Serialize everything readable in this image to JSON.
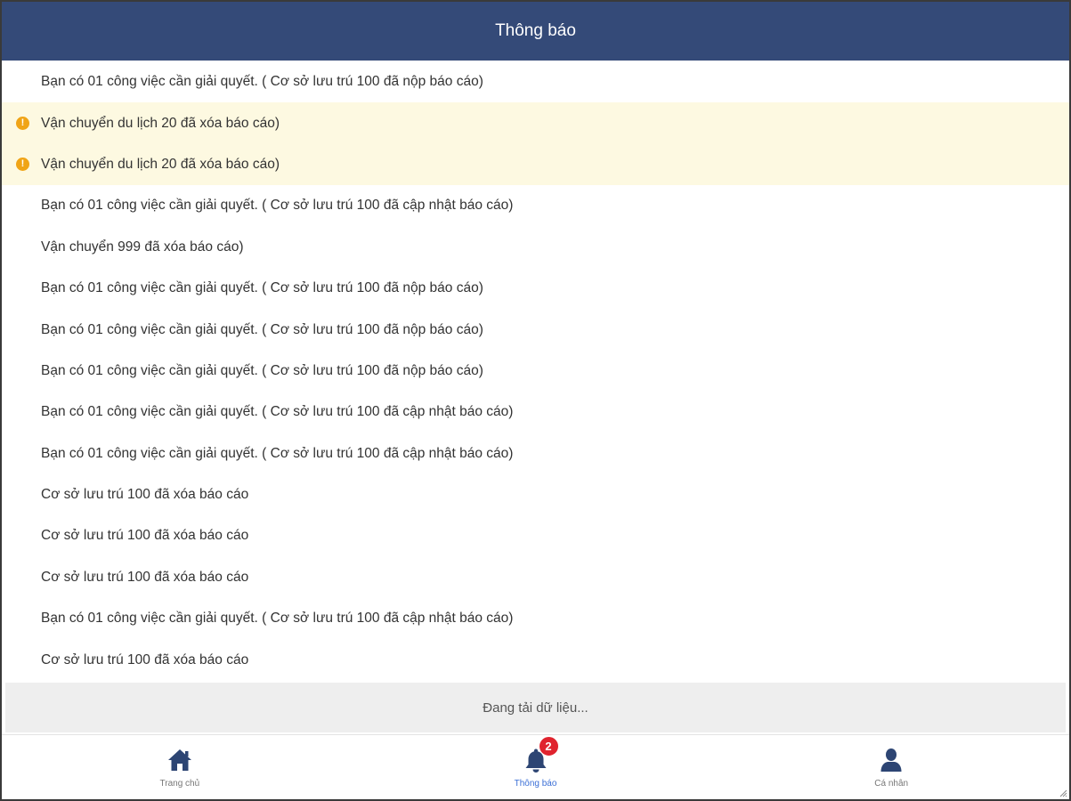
{
  "header": {
    "title": "Thông báo"
  },
  "notifications": [
    {
      "text": "Bạn có 01 công việc cần giải quyết. ( Cơ sở lưu trú 100 đã nộp báo cáo)",
      "unread": false
    },
    {
      "text": "Vận chuyển du lịch 20 đã xóa báo cáo)",
      "unread": true
    },
    {
      "text": "Vận chuyển du lịch 20 đã xóa báo cáo)",
      "unread": true
    },
    {
      "text": "Bạn có 01 công việc cần giải quyết. ( Cơ sở lưu trú 100 đã cập nhật báo cáo)",
      "unread": false
    },
    {
      "text": "Vận chuyển 999 đã xóa báo cáo)",
      "unread": false
    },
    {
      "text": "Bạn có 01 công việc cần giải quyết. ( Cơ sở lưu trú 100 đã nộp báo cáo)",
      "unread": false
    },
    {
      "text": "Bạn có 01 công việc cần giải quyết. ( Cơ sở lưu trú 100 đã nộp báo cáo)",
      "unread": false
    },
    {
      "text": "Bạn có 01 công việc cần giải quyết. ( Cơ sở lưu trú 100 đã nộp báo cáo)",
      "unread": false
    },
    {
      "text": "Bạn có 01 công việc cần giải quyết. ( Cơ sở lưu trú 100 đã cập nhật báo cáo)",
      "unread": false
    },
    {
      "text": "Bạn có 01 công việc cần giải quyết. ( Cơ sở lưu trú 100 đã cập nhật báo cáo)",
      "unread": false
    },
    {
      "text": "Cơ sở lưu trú 100 đã xóa báo cáo",
      "unread": false
    },
    {
      "text": "Cơ sở lưu trú 100 đã xóa báo cáo",
      "unread": false
    },
    {
      "text": "Cơ sở lưu trú 100 đã xóa báo cáo",
      "unread": false
    },
    {
      "text": "Bạn có 01 công việc cần giải quyết. ( Cơ sở lưu trú 100 đã cập nhật báo cáo)",
      "unread": false
    },
    {
      "text": "Cơ sở lưu trú 100 đã xóa báo cáo",
      "unread": false
    }
  ],
  "loading_text": "Đang tải dữ liệu...",
  "tabbar": {
    "tabs": [
      {
        "label": "Trang chủ",
        "icon": "home-icon",
        "active": false
      },
      {
        "label": "Thông báo",
        "icon": "bell-icon",
        "active": true,
        "badge": "2"
      },
      {
        "label": "Cá nhân",
        "icon": "user-icon",
        "active": false
      }
    ]
  },
  "colors": {
    "header_bg": "#344a78",
    "unread_bg": "#fdf9e1",
    "warning": "#f0a416",
    "badge": "#e0232e",
    "active_tab": "#3b6fd6"
  }
}
